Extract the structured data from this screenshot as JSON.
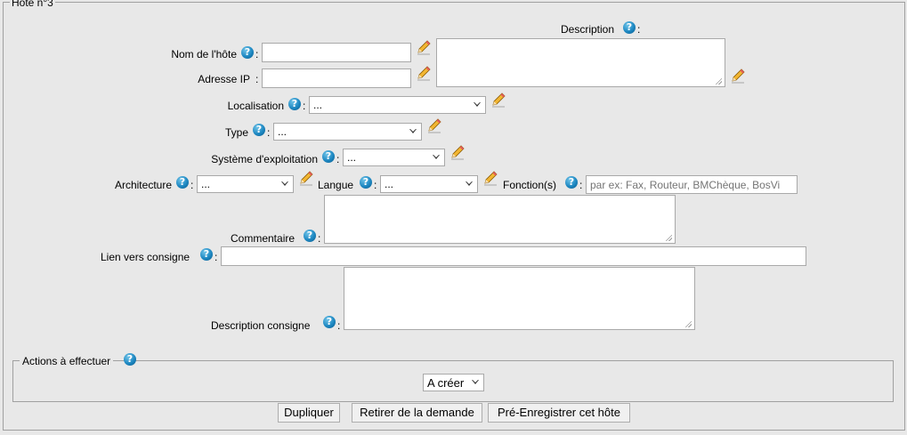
{
  "host": {
    "legend": "Hôte n°3",
    "fields": {
      "hostname_label": "Nom de l'hôte",
      "hostname_value": "",
      "ip_label": "Adresse IP",
      "ip_value": "",
      "description_label": "Description",
      "location_label": "Localisation",
      "location_value": "...",
      "type_label": "Type",
      "type_value": "...",
      "os_label": "Système d'exploitation",
      "os_value": "...",
      "architecture_label": "Architecture",
      "architecture_value": "...",
      "language_label": "Langue",
      "language_value": "...",
      "functions_label": "Fonction(s)",
      "functions_placeholder": "par ex: Fax, Routeur, BMChèque, BosVi",
      "comment_label": "Commentaire",
      "instruction_link_label": "Lien vers consigne",
      "instruction_desc_label": "Description consigne"
    },
    "colon": ":",
    "help_glyph": "?",
    "actions": {
      "legend": "Actions à effectuer",
      "selected": "A créer"
    },
    "buttons": {
      "duplicate": "Dupliquer",
      "remove": "Retirer de la demande",
      "pre_save": "Pré-Enregistrer cet hôte"
    }
  },
  "colors": {
    "background": "#e8e8e8",
    "help_icon": "#1e88c2",
    "pencil": "#f2b632"
  },
  "icons": {
    "help": "help-circle-icon",
    "edit": "pencil-icon",
    "dropdown": "chevron-down-icon"
  }
}
